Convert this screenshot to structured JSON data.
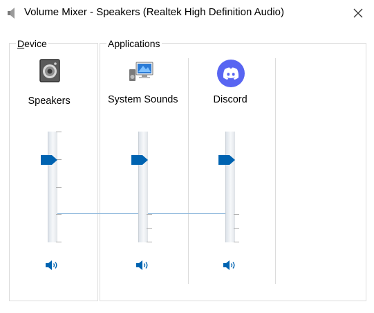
{
  "window": {
    "title": "Volume Mixer - Speakers (Realtek High Definition Audio)"
  },
  "groups": {
    "device_label_first": "D",
    "device_label_rest": "evice",
    "applications_label": "Applications"
  },
  "columns": [
    {
      "label": "Speakers",
      "icon": "speaker-device-icon",
      "volume_percent": 75
    },
    {
      "label": "System Sounds",
      "icon": "system-sounds-icon",
      "volume_percent": 75
    },
    {
      "label": "Discord",
      "icon": "discord-icon",
      "volume_percent": 75
    }
  ],
  "colors": {
    "accent": "#0063b1",
    "discord": "#5865f2"
  }
}
